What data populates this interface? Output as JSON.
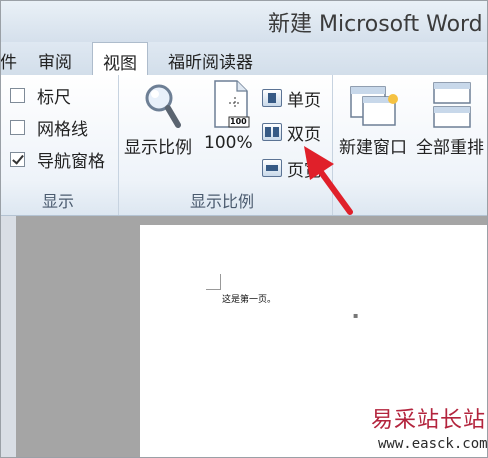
{
  "window": {
    "title": "新建 Microsoft Word"
  },
  "tabs": [
    {
      "label": "件"
    },
    {
      "label": "审阅"
    },
    {
      "label": "视图"
    },
    {
      "label": "福昕阅读器"
    }
  ],
  "show_group": {
    "checkboxes": [
      {
        "label": "标尺",
        "checked": false
      },
      {
        "label": "网格线",
        "checked": false
      },
      {
        "label": "导航窗格",
        "checked": true
      }
    ],
    "group_label": "显示"
  },
  "zoom_group": {
    "zoom_label": "显示比例",
    "zoom100_label": "100%",
    "zoom100_icon_text": "100",
    "single_page_label": "单页",
    "two_pages_label": "双页",
    "page_width_label": "页宽",
    "group_label": "显示比例"
  },
  "window_group": {
    "new_window_label": "新建窗口",
    "arrange_all_label": "全部重排"
  },
  "document": {
    "text": "这是第一页。"
  },
  "watermark": {
    "brand": "易采站长站",
    "url": "www.easck.com"
  },
  "colors": {
    "arrow": "#e0202a",
    "ribbon_bg": "#eef3f9",
    "doc_bg": "#a5a5a5"
  }
}
